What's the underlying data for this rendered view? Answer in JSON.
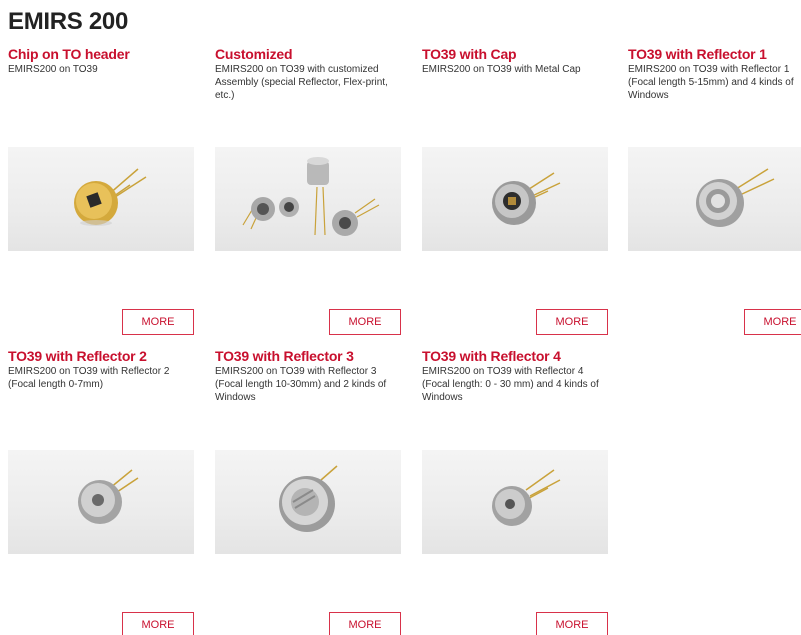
{
  "page": {
    "title": "EMIRS 200"
  },
  "products": [
    {
      "title": "Chip on TO header",
      "desc": "EMIRS200 on TO39",
      "image": "to39-open-header-photo",
      "more": "MORE"
    },
    {
      "title": "Customized",
      "desc": "EMIRS200 on TO39 with customized Assembly (special Reflector, Flex-print, etc.)",
      "image": "customized-assemblies-photo",
      "more": "MORE"
    },
    {
      "title": "TO39 with Cap",
      "desc": "EMIRS200 on TO39 with Metal Cap",
      "image": "to39-metal-cap-photo",
      "more": "MORE"
    },
    {
      "title": "TO39 with Reflector 1",
      "desc": "EMIRS200 on TO39 with Reflector 1 (Focal length 5-15mm) and 4 kinds of Windows",
      "image": "reflector-1-photo",
      "more": "MORE"
    },
    {
      "title": "TO39 with Reflector 2",
      "desc": "EMIRS200 on TO39 with Reflector 2 (Focal length 0-7mm)",
      "image": "reflector-2-photo",
      "more": "MORE"
    },
    {
      "title": "TO39 with Reflector 3",
      "desc": "EMIRS200 on TO39 with Reflector 3 (Focal length 10-30mm) and 2 kinds of Windows",
      "image": "reflector-3-photo",
      "more": "MORE"
    },
    {
      "title": "TO39 with Reflector 4",
      "desc": "EMIRS200 on TO39 with Reflector 4 (Focal length: 0 - 30 mm) and 4 kinds of Windows",
      "image": "reflector-4-photo",
      "more": "MORE"
    }
  ],
  "colors": {
    "accent": "#c8102e",
    "border": "#d8324a",
    "text": "#333333",
    "title": "#222222"
  }
}
